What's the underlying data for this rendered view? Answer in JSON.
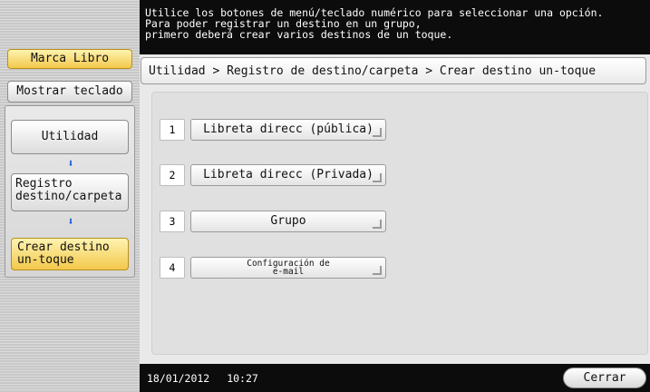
{
  "message": {
    "text": "Utilice los botones de menú/teclado numérico para seleccionar una opción.\nPara poder registrar un destino en un grupo,\nprimero deberá crear varios destinos de un toque."
  },
  "left": {
    "bookmark_label": "Marca Libro",
    "keyboard_label": "Mostrar teclado",
    "path": [
      {
        "label": "Utilidad"
      },
      {
        "label": "Registro\ndestino/carpeta"
      },
      {
        "label": "Crear destino\nun-toque"
      }
    ]
  },
  "breadcrumb": "Utilidad > Registro de destino/carpeta > Crear destino un-toque",
  "options": [
    {
      "num": "1",
      "label": "Libreta direcc (pública)"
    },
    {
      "num": "2",
      "label": "Libreta direcc (Privada)"
    },
    {
      "num": "3",
      "label": "Grupo"
    },
    {
      "num": "4",
      "label": "Configuración de\ne-mail"
    }
  ],
  "footer": {
    "date": "18/01/2012",
    "time": "10:27",
    "close_label": "Cerrar"
  },
  "colors": {
    "highlight": "#f2c84a",
    "arrow": "#1b57d8",
    "bar": "#0c0c0c"
  }
}
